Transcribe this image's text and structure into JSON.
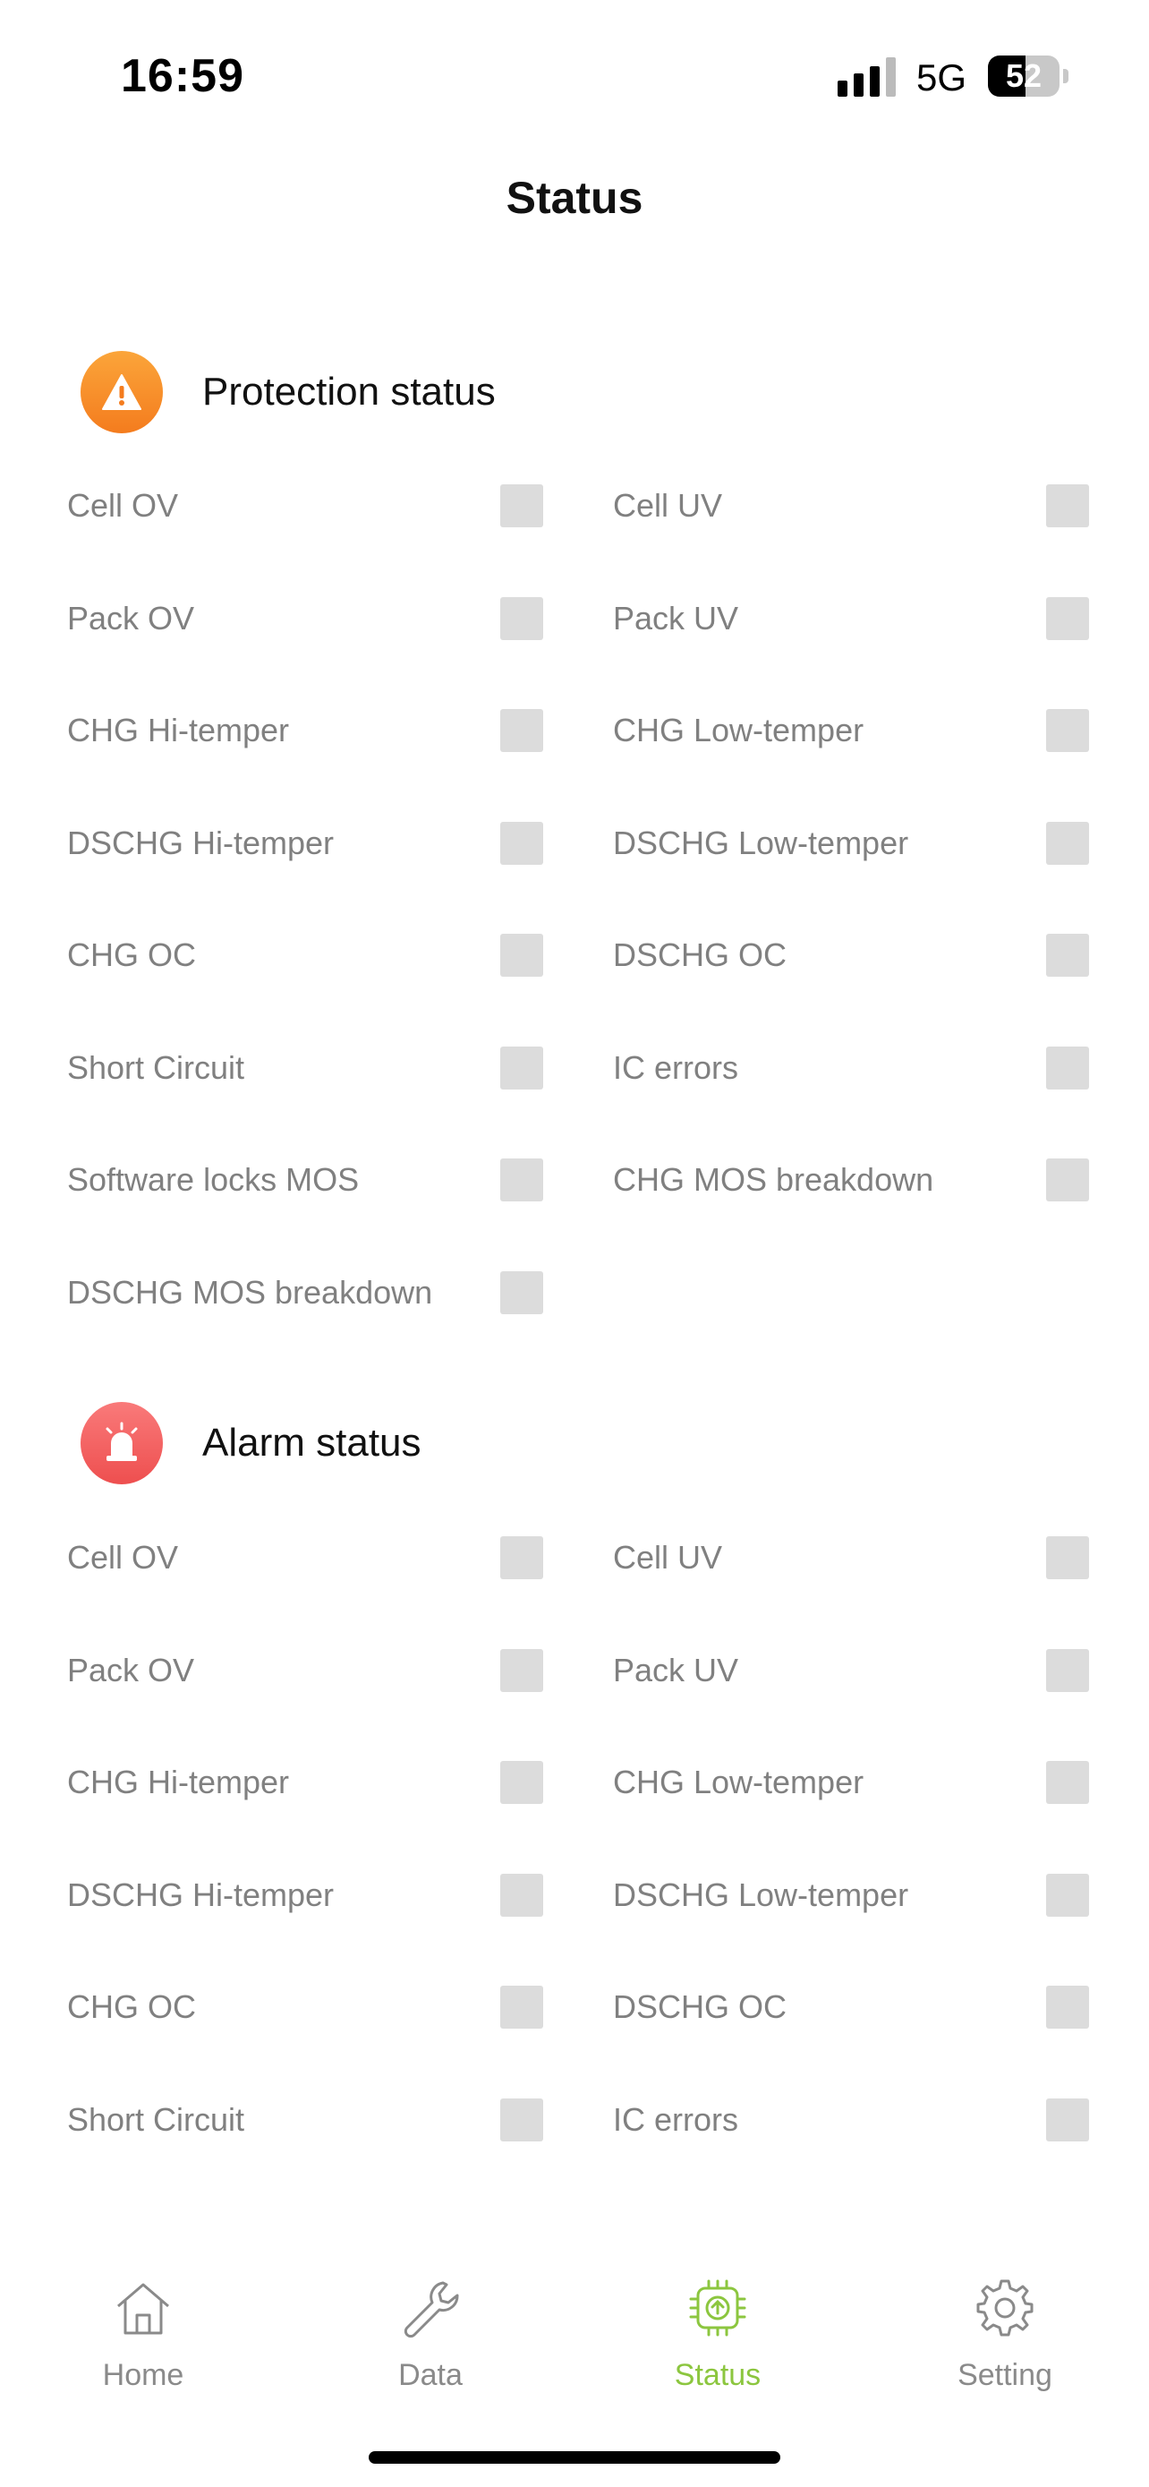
{
  "status_bar": {
    "time": "16:59",
    "network": "5G",
    "battery": "52",
    "battery_level": 0.52
  },
  "title": "Status",
  "protection": {
    "title": "Protection status",
    "icon": "warning-icon",
    "color": "#f7931e",
    "items": [
      {
        "label": "Cell OV"
      },
      {
        "label": "Cell UV"
      },
      {
        "label": "Pack OV"
      },
      {
        "label": "Pack UV"
      },
      {
        "label": "CHG Hi-temper"
      },
      {
        "label": "CHG Low-temper"
      },
      {
        "label": "DSCHG Hi-temper"
      },
      {
        "label": "DSCHG Low-temper"
      },
      {
        "label": "CHG OC"
      },
      {
        "label": "DSCHG OC"
      },
      {
        "label": "Short Circuit"
      },
      {
        "label": "IC errors"
      },
      {
        "label": "Software locks MOS"
      },
      {
        "label": "CHG MOS breakdown"
      },
      {
        "label": "DSCHG MOS breakdown"
      }
    ]
  },
  "alarm": {
    "title": "Alarm status",
    "icon": "alarm-siren-icon",
    "color": "#f05a5a",
    "items": [
      {
        "label": "Cell OV"
      },
      {
        "label": "Cell UV"
      },
      {
        "label": "Pack OV"
      },
      {
        "label": "Pack UV"
      },
      {
        "label": "CHG Hi-temper"
      },
      {
        "label": "CHG Low-temper"
      },
      {
        "label": "DSCHG Hi-temper"
      },
      {
        "label": "DSCHG Low-temper"
      },
      {
        "label": "CHG OC"
      },
      {
        "label": "DSCHG OC"
      },
      {
        "label": "Short Circuit"
      },
      {
        "label": "IC errors"
      }
    ]
  },
  "tabs": [
    {
      "label": "Home",
      "icon": "home-icon"
    },
    {
      "label": "Data",
      "icon": "wrench-icon"
    },
    {
      "label": "Status",
      "icon": "chip-upload-icon",
      "active": true
    },
    {
      "label": "Setting",
      "icon": "gear-icon"
    }
  ],
  "colors": {
    "accent": "#8cc63f",
    "inactive_tab": "#8a8a8a",
    "indicator_box": "#dcdcdc"
  }
}
